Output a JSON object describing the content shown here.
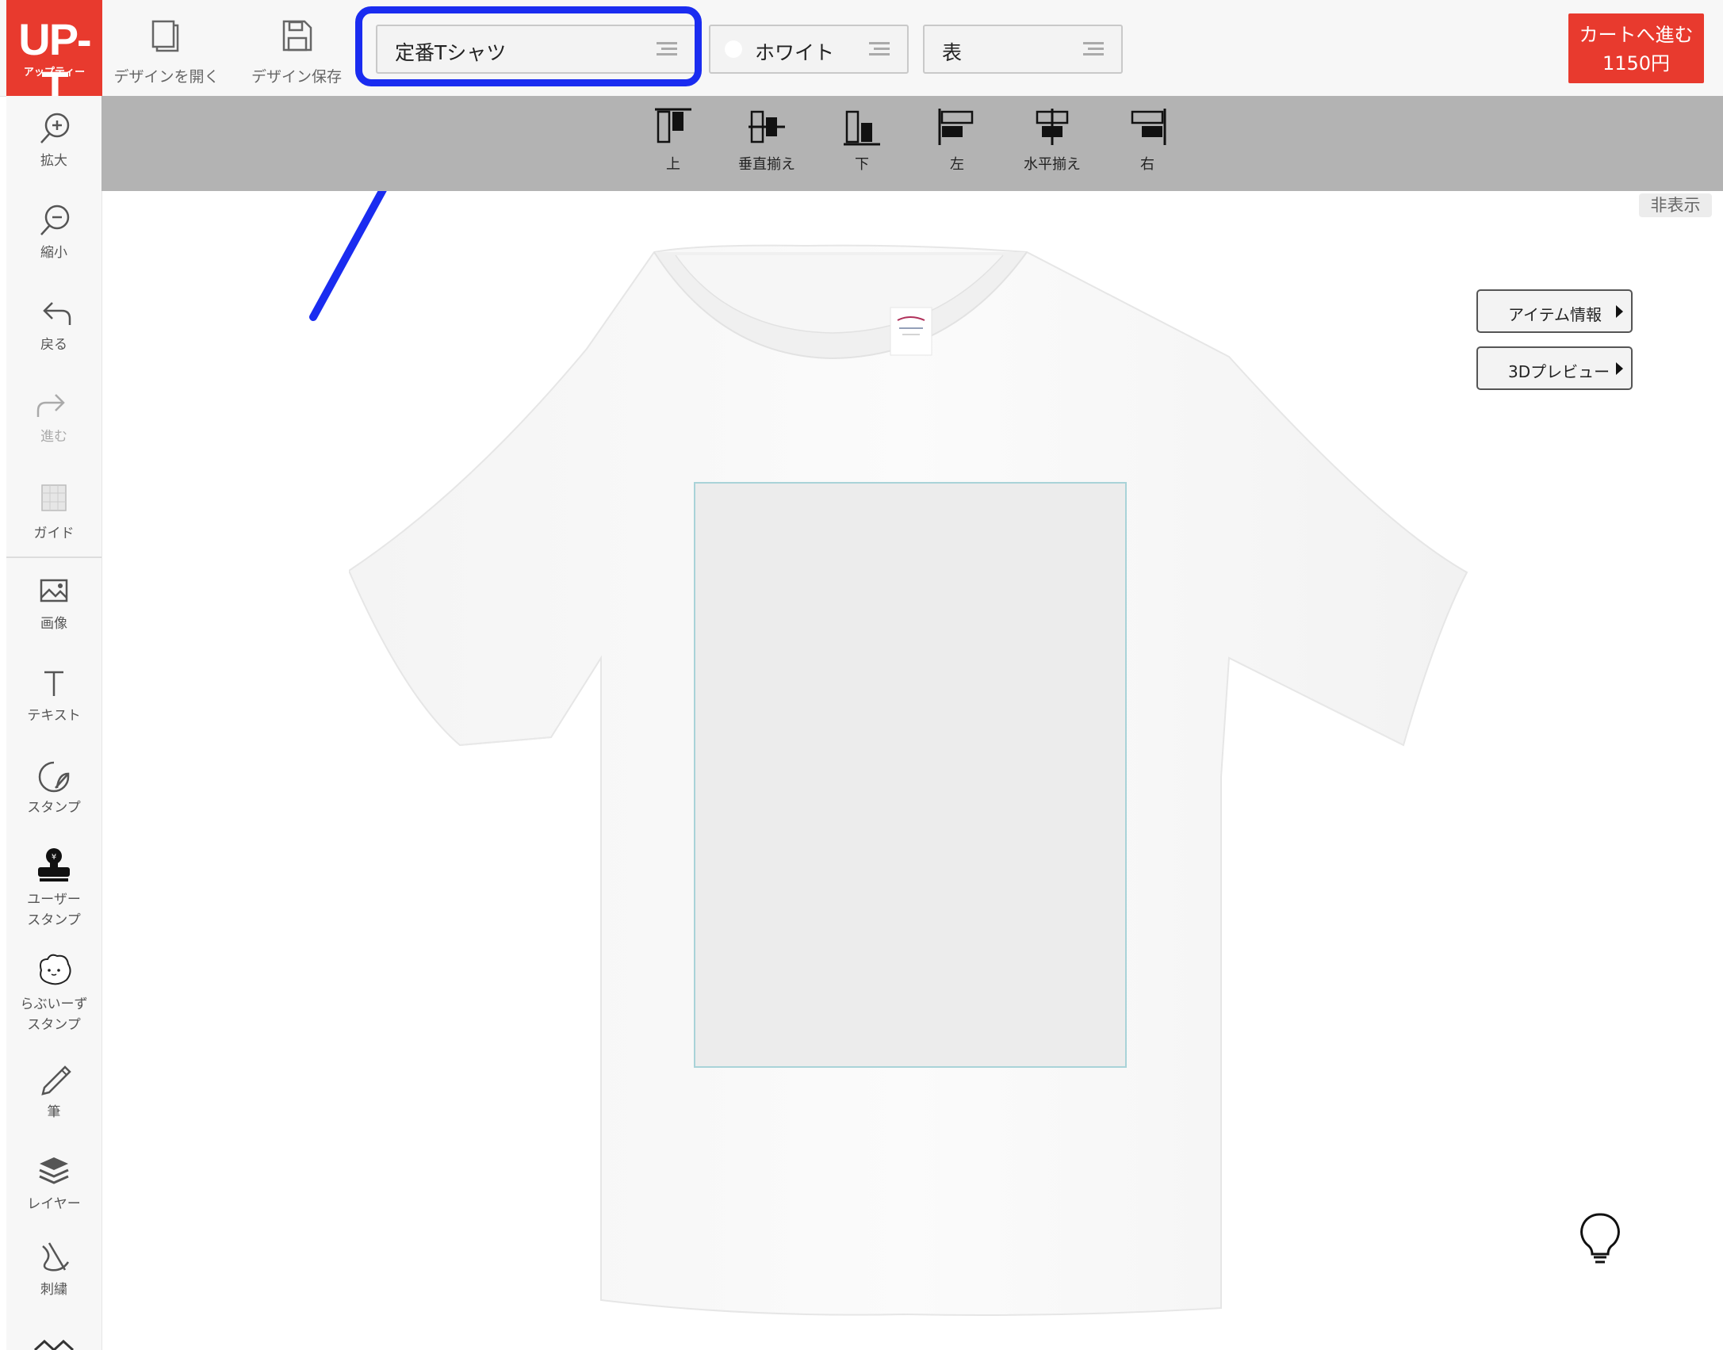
{
  "logo": {
    "main": "UP-T",
    "sub": "アップティー"
  },
  "toolbar": {
    "open_design": "デザインを開く",
    "save_design": "デザイン保存"
  },
  "selects": {
    "item": "定番Tシャツ",
    "color": "ホワイト",
    "side": "表"
  },
  "cart": {
    "label": "カートへ進む",
    "price": "1150円"
  },
  "sidebar": {
    "zoom_in": "拡大",
    "zoom_out": "縮小",
    "undo": "戻る",
    "redo": "進む",
    "guide": "ガイド",
    "image": "画像",
    "text": "テキスト",
    "stamp": "スタンプ",
    "user_stamp_1": "ユーザー",
    "user_stamp_2": "スタンプ",
    "lovies_stamp_1": "らぶいーず",
    "lovies_stamp_2": "スタンプ",
    "brush": "筆",
    "layer": "レイヤー",
    "embroidery": "刺繍"
  },
  "align": {
    "top": "上",
    "vcenter": "垂直揃え",
    "bottom": "下",
    "left": "左",
    "hcenter": "水平揃え",
    "right": "右"
  },
  "hide_label": "非表示",
  "panels": {
    "item_info": "アイテム情報",
    "preview3d": "3Dプレビュー"
  },
  "colors": {
    "brand_red": "#e83a2e",
    "highlight_blue": "#1a2cf0",
    "align_bar": "#b3b3b3"
  }
}
